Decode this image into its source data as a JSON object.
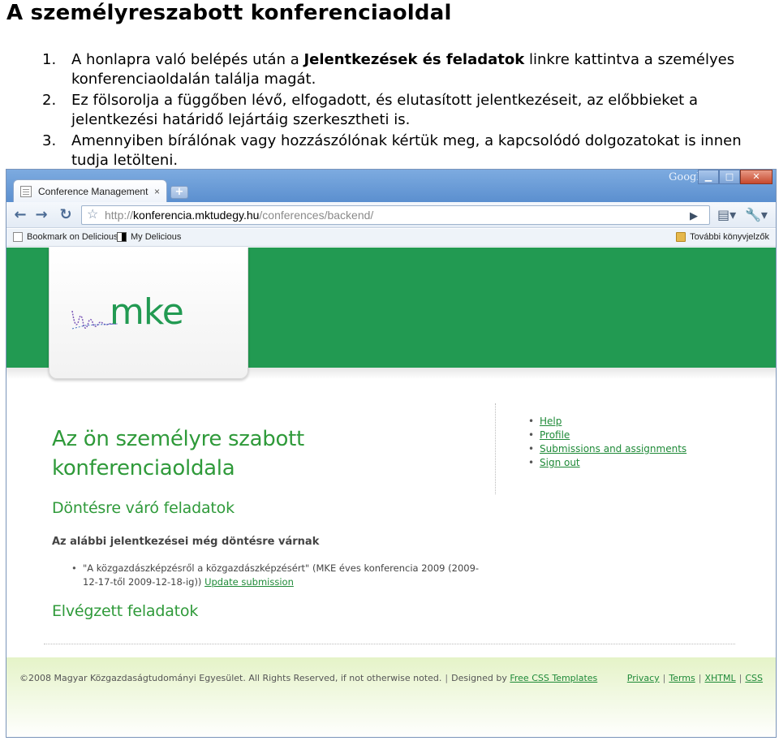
{
  "document": {
    "title": "A személyreszabott konferenciaoldal",
    "steps": [
      {
        "number": "1.",
        "text_before": "A honlapra való belépés után a ",
        "bold": "Jelentkezések és feladatok",
        "text_after": " linkre kattintva a személyes konferenciaoldalán találja magát."
      },
      {
        "number": "2.",
        "text": "Ez fölsorolja a függőben lévő, elfogadott, és elutasított jelentkezéseit, az előbbieket a jelentkezési határidő lejártáig szerkesztheti is."
      },
      {
        "number": "3.",
        "text": "Amennyiben bírálónak vagy hozzászólónak kértük meg, a kapcsolódó dolgozatokat is innen tudja letölteni."
      }
    ]
  },
  "browser": {
    "tab_label": "Conference Management S...",
    "tab_close": "×",
    "new_tab": "+",
    "google_label": "Google",
    "window_buttons": {
      "minimize": "▁",
      "maximize": "□",
      "close": "✕"
    },
    "nav": {
      "back": "←",
      "forward": "→",
      "reload": "↻",
      "star": "☆"
    },
    "url": {
      "scheme": "http://",
      "host": "konferencia.mktudegy.hu",
      "path": "/conferences/backend/"
    },
    "go_icon": "▶",
    "page_menu_icon": "▤▾",
    "tools_menu_icon": "🔧▾",
    "bookmarks": [
      {
        "label": "Bookmark on Delicious",
        "icon": "page-icon"
      },
      {
        "label": "My Delicious",
        "icon": "delicious-icon"
      }
    ],
    "other_bookmarks": "További könyvjelzők"
  },
  "site": {
    "logo_text": "mke",
    "page_title_line1": "Az ön személyre szabott",
    "page_title_line2": "konferenciaoldala",
    "pending_heading": "Döntésre váró feladatok",
    "pending_subheading": "Az alábbi jelentkezései még döntésre várnak",
    "pending_items": [
      {
        "text": "\"A közgazdászképzésről a közgazdászképzésért\" (MKE éves konferencia 2009 (2009-12-17-től 2009-12-18-ig))",
        "link": "Update submission"
      }
    ],
    "done_heading": "Elvégzett feladatok",
    "sidebar_links": [
      "Help",
      "Profile",
      "Submissions and assignments",
      "Sign out"
    ],
    "footer": {
      "copyright": "©2008 Magyar Közgazdaságtudományi Egyesület. All Rights Reserved, if not otherwise noted.",
      "separator": "|",
      "designed_by": "Designed by",
      "designer_link": "Free CSS Templates",
      "links": [
        "Privacy",
        "Terms",
        "XHTML",
        "CSS"
      ]
    }
  },
  "colors": {
    "header_green": "#229a52",
    "title_green": "#2f9a3a",
    "link_green": "#1f8a38",
    "footer_tint": "#e5f3c8"
  }
}
